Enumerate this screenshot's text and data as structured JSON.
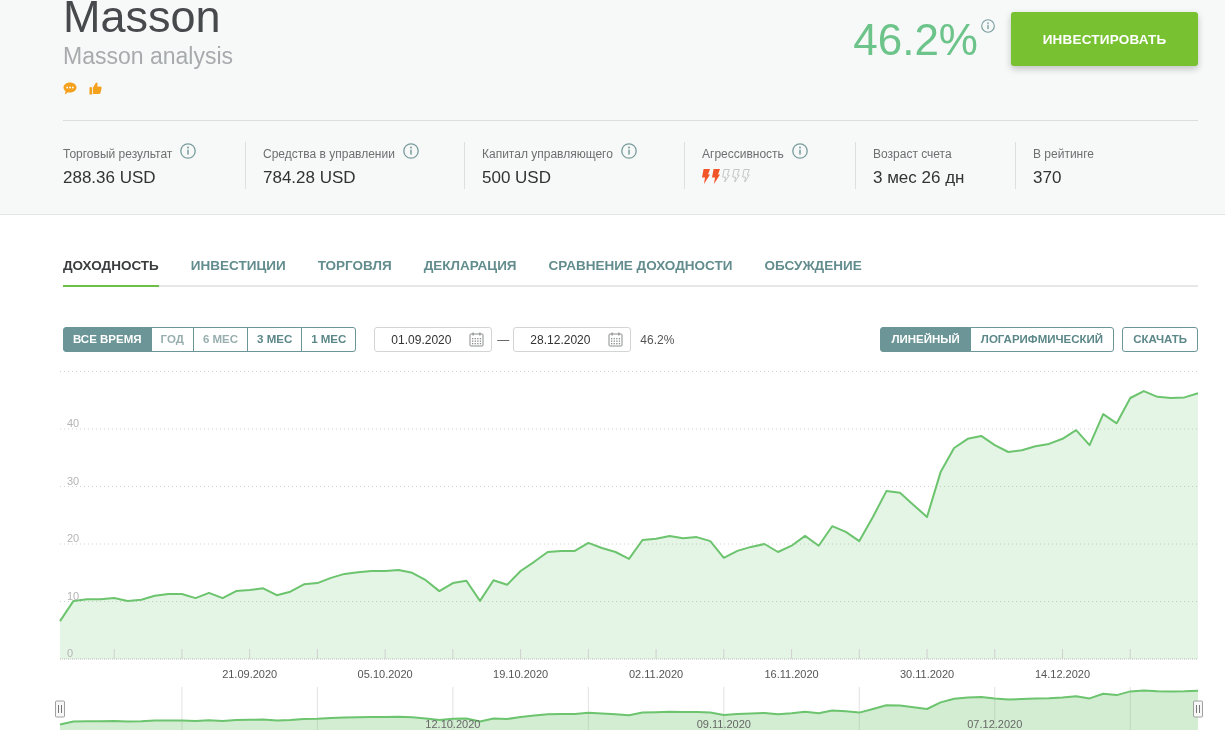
{
  "header": {
    "title": "Masson",
    "subtitle": "Masson analysis",
    "return_value": "46.2%",
    "invest_button": "ИНВЕСТИРОВАТЬ"
  },
  "stats": [
    {
      "kind": "text",
      "label": "Торговый результат",
      "info": true,
      "value": "288.36 USD"
    },
    {
      "kind": "text",
      "label": "Средства в управлении",
      "info": true,
      "value": "784.28 USD"
    },
    {
      "kind": "text",
      "label": "Капитал управляющего",
      "info": true,
      "value": "500 USD"
    },
    {
      "kind": "rating",
      "label": "Агрессивность",
      "info": true,
      "stars": 2
    },
    {
      "kind": "text",
      "label": "Возраст счета",
      "info": false,
      "value": "3 мес 26 дн"
    },
    {
      "kind": "text",
      "label": "В рейтинге",
      "info": false,
      "value": "370"
    }
  ],
  "tabs": [
    {
      "label": "ДОХОДНОСТЬ",
      "selected": true
    },
    {
      "label": "ИНВЕСТИЦИИ",
      "selected": false
    },
    {
      "label": "ТОРГОВЛЯ",
      "selected": false
    },
    {
      "label": "ДЕКЛАРАЦИЯ",
      "selected": false
    },
    {
      "label": "СРАВНЕНИЕ ДОХОДНОСТИ",
      "selected": false
    },
    {
      "label": "ОБСУЖДЕНИЕ",
      "selected": false
    }
  ],
  "toolbar": {
    "periods": [
      {
        "label": "ВСЕ ВРЕМЯ",
        "selected": true,
        "disabled": false
      },
      {
        "label": "ГОД",
        "selected": false,
        "disabled": true
      },
      {
        "label": "6 МЕС",
        "selected": false,
        "disabled": true
      },
      {
        "label": "3 МЕС",
        "selected": false,
        "disabled": false
      },
      {
        "label": "1 МЕС",
        "selected": false,
        "disabled": false
      }
    ],
    "date_from": "01.09.2020",
    "date_separator": "—",
    "date_to": "28.12.2020",
    "period_return": "46.2%",
    "scales": [
      {
        "label": "ЛИНЕЙНЫЙ",
        "selected": true
      },
      {
        "label": "ЛОГАРИФМИЧЕСКИЙ",
        "selected": false
      }
    ],
    "download_button": "СКАЧАТЬ"
  },
  "chart": {
    "chart_data": {
      "type": "area",
      "categories": [
        null,
        null,
        null,
        null,
        null,
        null,
        null,
        null,
        null,
        null,
        null,
        null,
        null,
        null,
        "21.09.2020",
        null,
        null,
        null,
        null,
        null,
        null,
        null,
        null,
        null,
        "05.10.2020",
        null,
        null,
        null,
        null,
        null,
        null,
        null,
        null,
        null,
        "19.10.2020",
        null,
        null,
        null,
        null,
        null,
        null,
        null,
        null,
        null,
        "02.11.2020",
        null,
        null,
        null,
        null,
        null,
        null,
        null,
        null,
        null,
        "16.11.2020",
        null,
        null,
        null,
        null,
        null,
        null,
        null,
        null,
        null,
        "30.11.2020",
        null,
        null,
        null,
        null,
        null,
        null,
        null,
        null,
        null,
        "14.12.2020",
        null,
        null,
        null,
        null,
        null,
        null,
        null,
        null,
        null,
        null
      ],
      "series": [
        {
          "color": "#6cc46e",
          "values": [
            6.6,
            10.1,
            10.4,
            10.4,
            10.6,
            10.1,
            10.3,
            11.0,
            11.3,
            11.3,
            10.6,
            11.5,
            10.6,
            11.8,
            12.0,
            12.3,
            11.1,
            11.7,
            13.0,
            13.2,
            14.1,
            14.8,
            15.1,
            15.3,
            15.3,
            15.5,
            15.0,
            13.7,
            11.8,
            13.2,
            13.6,
            10.1,
            13.7,
            12.9,
            15.3,
            16.9,
            18.6,
            18.8,
            18.8,
            20.2,
            19.3,
            18.6,
            17.4,
            20.7,
            20.9,
            21.4,
            21.0,
            21.2,
            20.5,
            17.6,
            18.8,
            19.5,
            20.0,
            18.6,
            19.7,
            21.4,
            19.7,
            23.1,
            22.1,
            20.5,
            24.7,
            29.2,
            28.9,
            26.8,
            24.7,
            32.5,
            36.7,
            38.3,
            38.8,
            37.2,
            36.0,
            36.3,
            37.0,
            37.4,
            38.3,
            39.8,
            37.2,
            42.6,
            41.0,
            45.4,
            46.6,
            45.6,
            45.4,
            45.5,
            46.2
          ]
        }
      ],
      "ylim": [
        0,
        50
      ],
      "yticks": [
        0,
        10,
        20,
        30,
        40
      ],
      "grid": true
    },
    "navigator": {
      "labels": [
        "12.10.2020",
        "09.11.2020",
        "07.12.2020"
      ]
    }
  }
}
